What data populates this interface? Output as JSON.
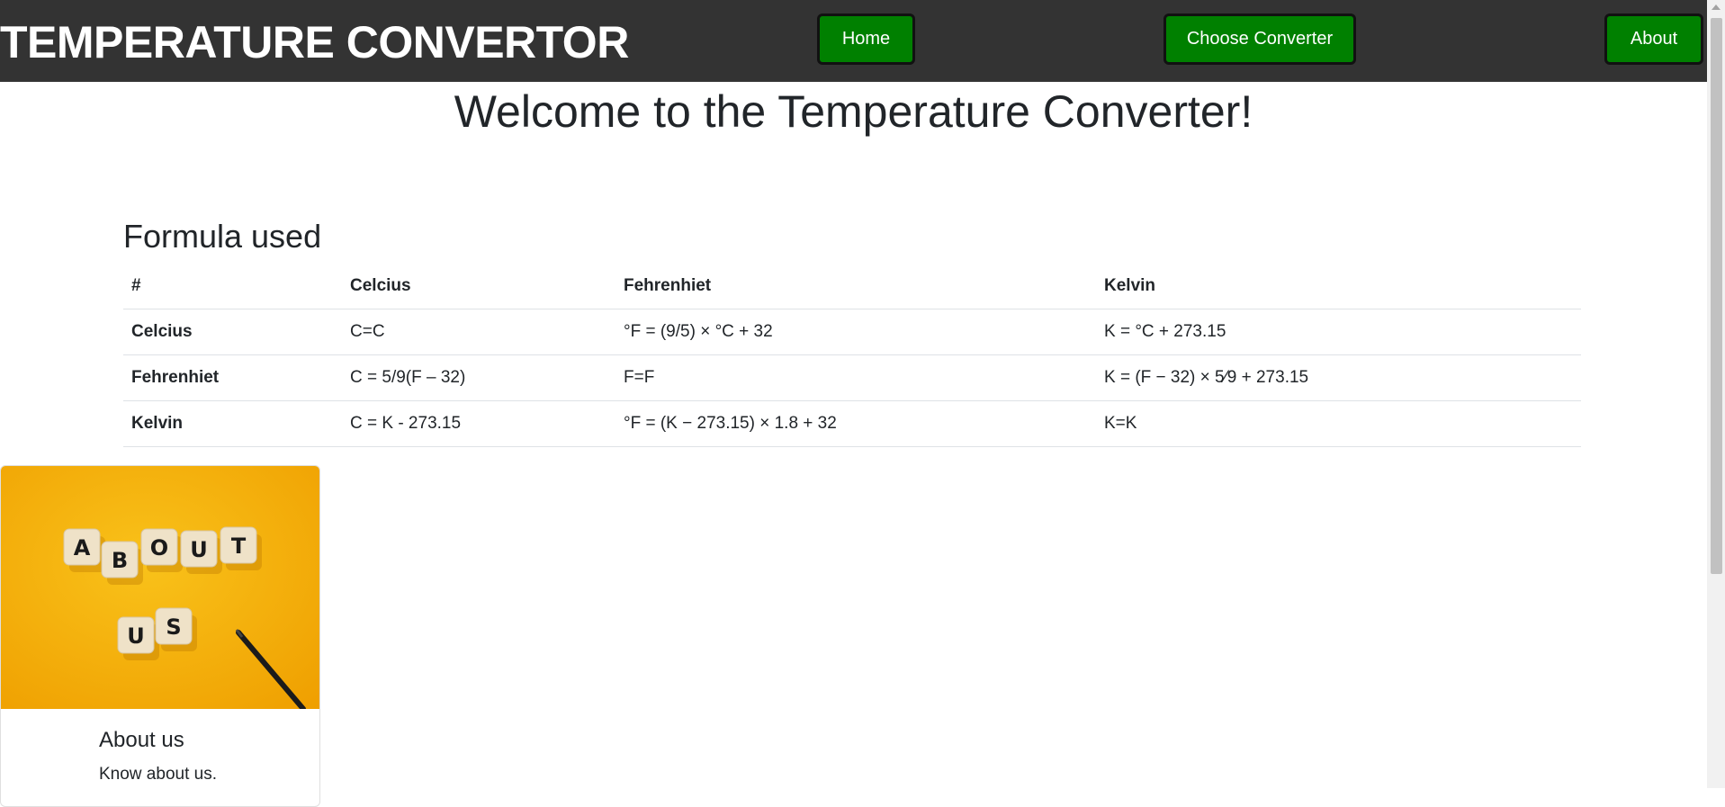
{
  "navbar": {
    "brand": "TEMPERATURE CONVERTOR",
    "home_label": "Home",
    "choose_label": "Choose Converter",
    "about_label": "About"
  },
  "main": {
    "heading": "Welcome to the Temperature Converter!",
    "section_title": "Formula used"
  },
  "table": {
    "headers": [
      "#",
      "Celcius",
      "Fehrenhiet",
      "Kelvin"
    ],
    "rows": [
      [
        "Celcius",
        "C=C",
        "°F = (9/5) × °C + 32",
        "K = °C + 273.15"
      ],
      [
        "Fehrenhiet",
        "C = 5/9(F – 32)",
        "F=F",
        "K = (F − 32) × 5⁄9 + 273.15"
      ],
      [
        "Kelvin",
        "C = K - 273.15",
        "°F = (K − 273.15) × 1.8 + 32",
        "K=K"
      ]
    ]
  },
  "card": {
    "image_letters": [
      "A",
      "B",
      "O",
      "U",
      "T",
      "U",
      "S"
    ],
    "title": "About us",
    "text": "Know about us."
  },
  "colors": {
    "navbar_bg": "#333333",
    "button_bg": "#008000",
    "card_image_bg": "#f5b10a"
  }
}
